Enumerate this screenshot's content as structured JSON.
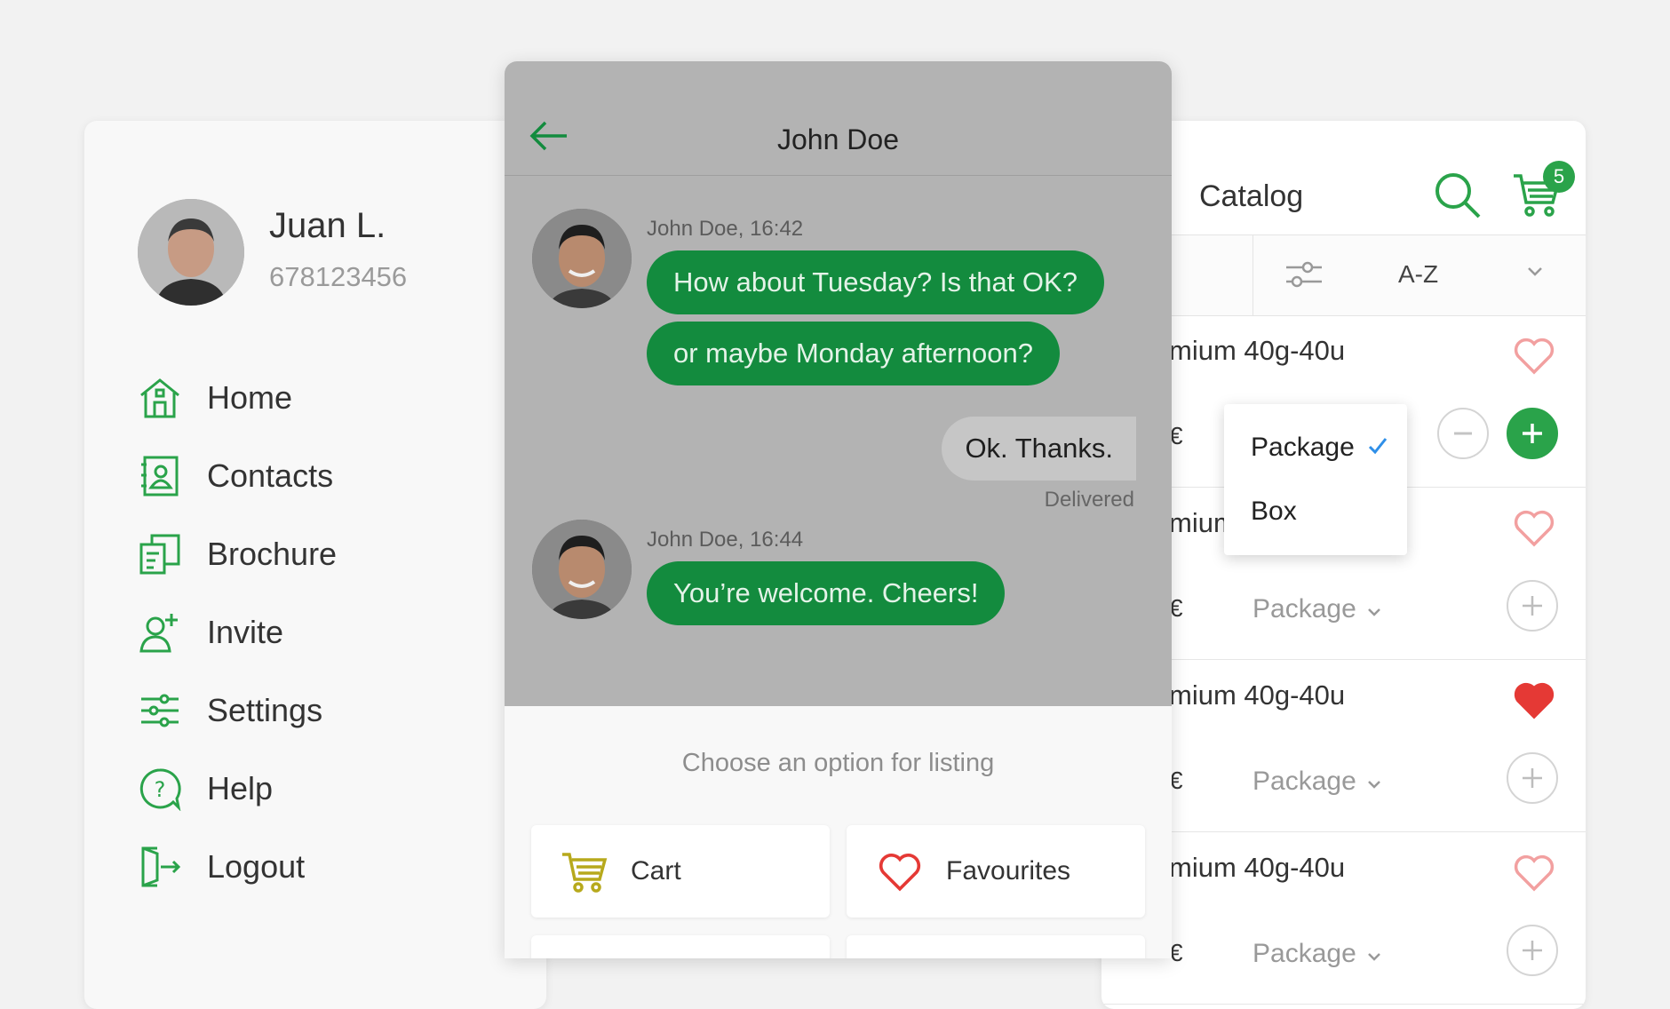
{
  "drawer": {
    "user_name": "Juan L.",
    "user_phone": "678123456",
    "items": [
      {
        "label": "Home",
        "icon": "home-icon"
      },
      {
        "label": "Contacts",
        "icon": "contacts-icon"
      },
      {
        "label": "Brochure",
        "icon": "brochure-icon"
      },
      {
        "label": "Invite",
        "icon": "invite-icon"
      },
      {
        "label": "Settings",
        "icon": "settings-icon"
      },
      {
        "label": "Help",
        "icon": "help-icon"
      },
      {
        "label": "Logout",
        "icon": "logout-icon"
      }
    ]
  },
  "chat": {
    "title": "John Doe",
    "messages": [
      {
        "meta": "John Doe, 16:42",
        "lines": [
          "How about Tuesday? Is that OK?",
          "or maybe Monday afternoon?"
        ]
      },
      {
        "outgoing": "Ok. Thanks.",
        "status": "Delivered"
      },
      {
        "meta": "John Doe, 16:44",
        "lines": [
          "You’re welcome. Cheers!"
        ]
      }
    ],
    "options_title": "Choose an option for listing",
    "options": [
      {
        "label": "Cart",
        "icon": "cart-icon"
      },
      {
        "label": "Favourites",
        "icon": "heart-icon"
      }
    ]
  },
  "catalog": {
    "title": "Catalog",
    "cart_count": "5",
    "sort_label": "A-Z",
    "products": [
      {
        "name": "mium 40g-40u",
        "price": "€",
        "unit": "",
        "favourite": false
      },
      {
        "name": "mium 40g-40u",
        "price": "€",
        "unit": "Package",
        "favourite": false
      },
      {
        "name": "mium 40g-40u",
        "price": "€",
        "unit": "Package",
        "favourite": true
      },
      {
        "name": "mium 40g-40u",
        "price": "€",
        "unit": "Package",
        "favourite": false
      }
    ],
    "unit_menu": {
      "options": [
        "Package",
        "Box"
      ],
      "selected": "Package"
    }
  },
  "colors": {
    "accent": "#2aa34a",
    "chat_bubble": "#138b3e",
    "heart_red": "#e53935"
  }
}
